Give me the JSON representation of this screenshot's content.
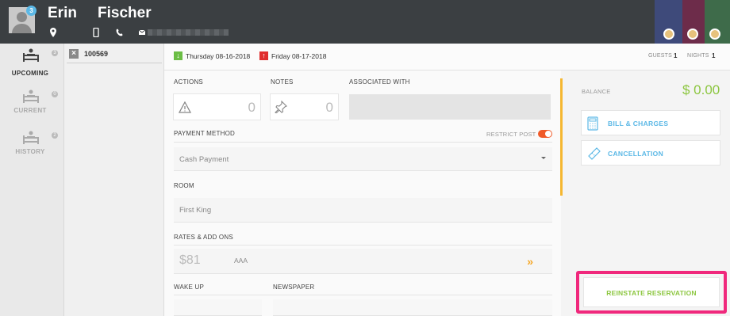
{
  "header": {
    "first_name": "Erin",
    "last_name": "Fischer",
    "badge_count": "3",
    "colors": {
      "bar": "#3b3f42"
    }
  },
  "sidebar": {
    "items": [
      {
        "label": "UPCOMING",
        "count": "3",
        "icon": "bed-icon"
      },
      {
        "label": "CURRENT",
        "count": "0",
        "icon": "bed-icon"
      },
      {
        "label": "HISTORY",
        "count": "2",
        "icon": "bed-icon"
      }
    ]
  },
  "reservation": {
    "number": "100569"
  },
  "datebar": {
    "arrival": "Thursday 08-16-2018",
    "departure": "Friday 08-17-2018",
    "guests_label": "GUESTS",
    "guests": "1",
    "nights_label": "NIGHTS",
    "nights": "1"
  },
  "form": {
    "actions_label": "ACTIONS",
    "actions_count": "0",
    "notes_label": "NOTES",
    "notes_count": "0",
    "associated_label": "ASSOCIATED WITH",
    "payment_label": "PAYMENT METHOD",
    "restrict_label": "RESTRICT POST",
    "payment_value": "Cash Payment",
    "room_label": "ROOM",
    "room_value": "First King",
    "rates_label": "RATES & ADD ONS",
    "rate_amount": "$81",
    "rate_code": "AAA",
    "wakeup_label": "WAKE UP",
    "newspaper_label": "NEWSPAPER"
  },
  "right": {
    "balance_label": "BALANCE",
    "balance_value": "$ 0.00",
    "bill_label": "BILL & CHARGES",
    "cancel_label": "CANCELLATION",
    "reinstate_label": "REINSTATE RESERVATION",
    "colors": {
      "accent_green": "#8cc63f",
      "accent_blue": "#5bb8e6",
      "highlight": "#f0287c"
    }
  }
}
